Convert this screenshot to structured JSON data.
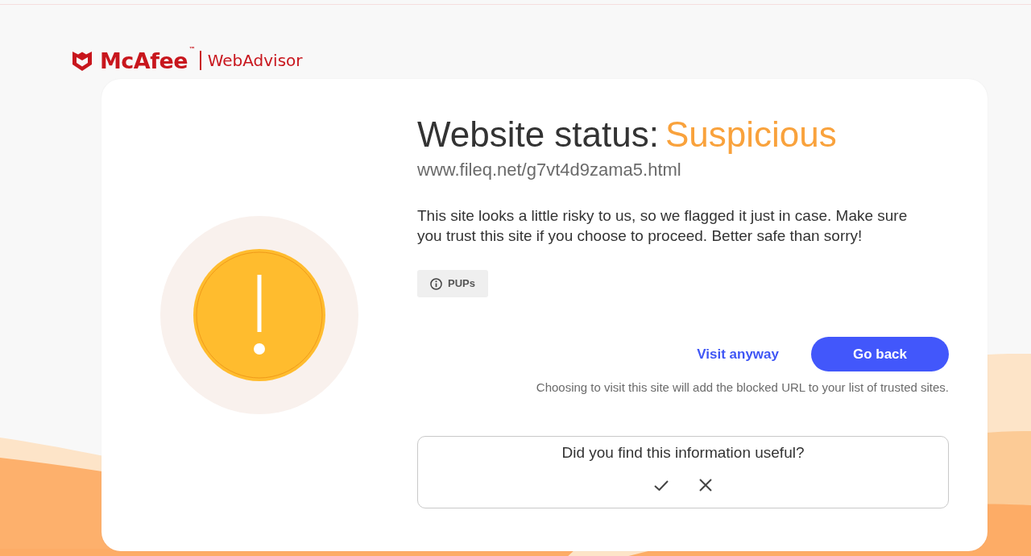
{
  "brand": {
    "name": "McAfee$^{™}$",
    "product": "WebAdvisor"
  },
  "status": {
    "label": "Website status:",
    "value": "Suspicious",
    "kind": "warning"
  },
  "url": "www.fileq.net/g7vt4d9zama5.html",
  "description": "This site looks a little risky to us, so we flagged it just in case. Make sure you trust this site if you choose to proceed. Better safe than sorry!",
  "tags": [
    {
      "label": "PUPs"
    }
  ],
  "actions": [
    {
      "label": "Visit anyway",
      "kind": "link"
    },
    {
      "label": "Go back",
      "kind": "primary"
    }
  ],
  "note": "Choosing to visit this site will add the blocked URL to your list of trusted sites.",
  "feedback": {
    "question": "Did you find this information useful?"
  }
}
